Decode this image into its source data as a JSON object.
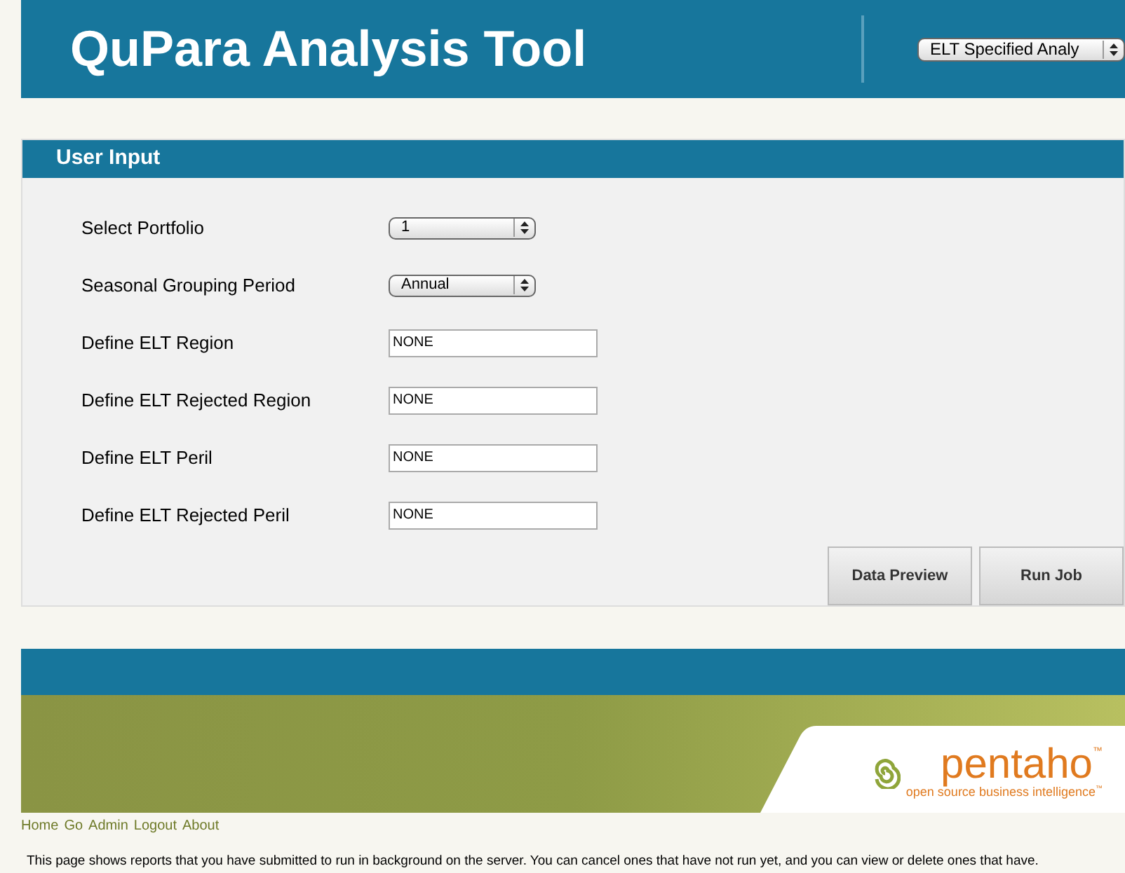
{
  "header": {
    "title": "QuPara Analysis Tool",
    "select_value": "ELT Specified Analy"
  },
  "panel": {
    "title": "User Input",
    "fields": [
      {
        "label": "Select Portfolio",
        "kind": "select",
        "value": "1"
      },
      {
        "label": "Seasonal Grouping Period",
        "kind": "select",
        "value": "Annual"
      },
      {
        "label": "Define ELT Region",
        "kind": "text",
        "value": "NONE"
      },
      {
        "label": "Define ELT Rejected Region",
        "kind": "text",
        "value": "NONE"
      },
      {
        "label": "Define ELT Peril",
        "kind": "text",
        "value": "NONE"
      },
      {
        "label": "Define ELT Rejected Peril",
        "kind": "text",
        "value": "NONE"
      }
    ],
    "buttons": [
      "Data Preview",
      "Run Job"
    ]
  },
  "banner": {
    "logo_text": "pentaho",
    "logo_mark": "™",
    "tagline": "open source business intelligence",
    "tagline_mark": "™"
  },
  "nav_links": [
    "Home",
    "Go",
    "Admin",
    "Logout",
    "About"
  ],
  "description": "This page shows reports that you have submitted to run in background on the server. You can cancel ones that have not run yet, and you can view or delete ones that have."
}
